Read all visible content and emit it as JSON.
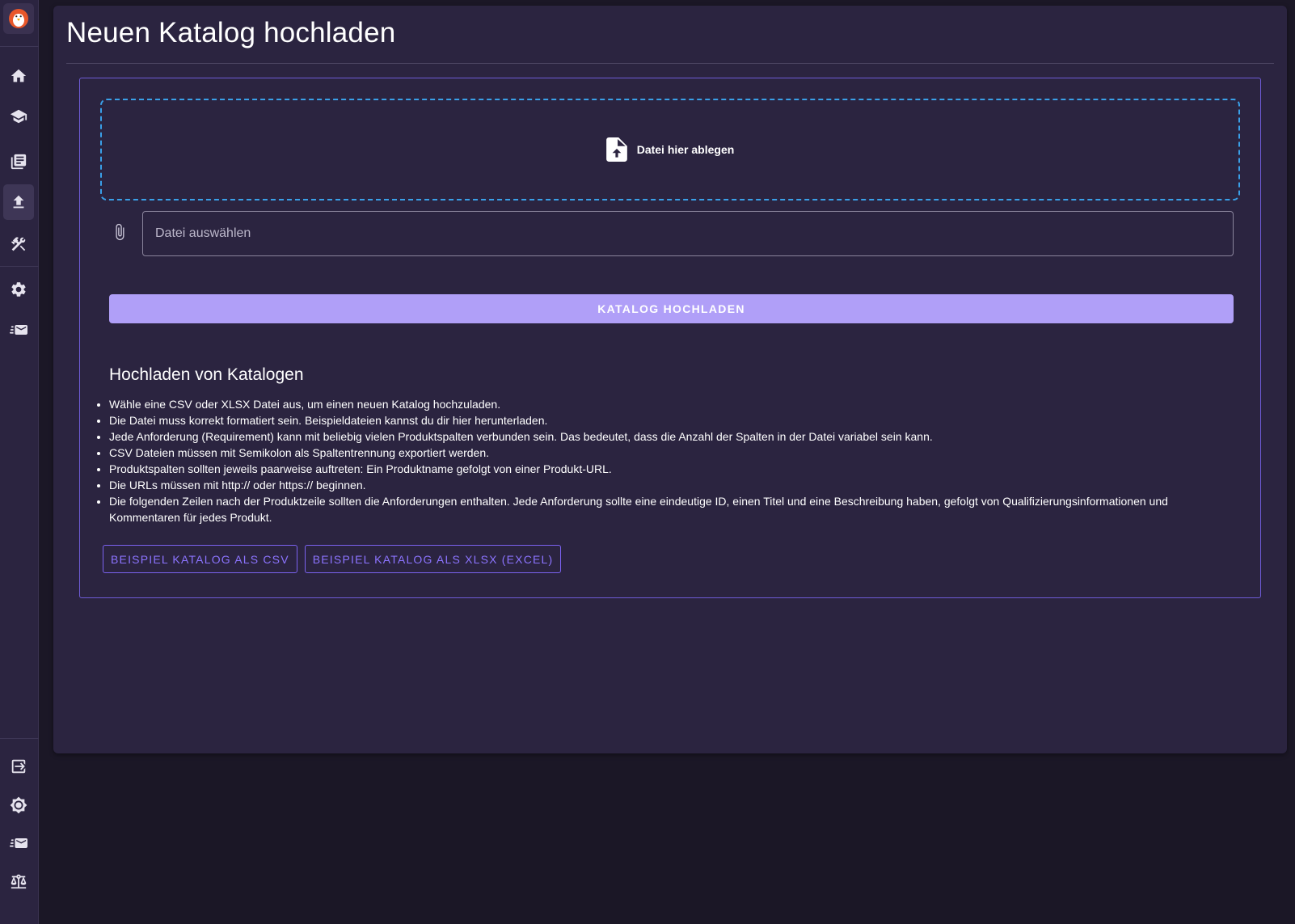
{
  "sidebar": {
    "logo": "penguin-logo",
    "items": [
      {
        "name": "home",
        "icon": "home-icon"
      },
      {
        "name": "courses",
        "icon": "graduation-cap-icon"
      },
      {
        "name": "catalogs",
        "icon": "library-books-icon"
      },
      {
        "name": "upload",
        "icon": "upload-icon",
        "active": true
      },
      {
        "name": "tools",
        "icon": "tools-icon"
      },
      {
        "name": "settings",
        "icon": "gear-icon"
      },
      {
        "name": "mail",
        "icon": "fast-mail-icon"
      }
    ],
    "bottom_items": [
      {
        "name": "logout",
        "icon": "logout-icon"
      },
      {
        "name": "theme",
        "icon": "brightness-icon"
      },
      {
        "name": "contact",
        "icon": "fast-mail-icon"
      },
      {
        "name": "legal",
        "icon": "scale-icon"
      }
    ]
  },
  "page": {
    "title": "Neuen Katalog hochladen"
  },
  "upload": {
    "dropzone_label": "Datei hier ablegen",
    "file_placeholder": "Datei auswählen",
    "file_value": "",
    "submit_label": "KATALOG HOCHLADEN"
  },
  "info": {
    "title": "Hochladen von Katalogen",
    "bullets": [
      "Wähle eine CSV oder XLSX Datei aus, um einen neuen Katalog hochzuladen.",
      "Die Datei muss korrekt formatiert sein. Beispieldateien kannst du dir hier herunterladen.",
      "Jede Anforderung (Requirement) kann mit beliebig vielen Produktspalten verbunden sein. Das bedeutet, dass die Anzahl der Spalten in der Datei variabel sein kann.",
      "CSV Dateien müssen mit Semikolon als Spaltentrennung exportiert werden.",
      "Produktspalten sollten jeweils paarweise auftreten: Ein Produktname gefolgt von einer Produkt-URL.",
      "Die URLs müssen mit http:// oder https:// beginnen.",
      "Die folgenden Zeilen nach der Produktzeile sollten die Anforderungen enthalten. Jede Anforderung sollte eine eindeutige ID, einen Titel und eine Beschreibung haben, gefolgt von Qualifizierungsinformationen und Kommentaren für jedes Produkt."
    ]
  },
  "examples": {
    "csv_label": "BEISPIEL KATALOG ALS CSV",
    "xlsx_label": "BEISPIEL KATALOG ALS XLSX (EXCEL)"
  },
  "colors": {
    "background": "#1b1726",
    "panel": "#2b2440",
    "accent": "#b09ff8",
    "outline": "#7b62f0",
    "dropzone_border": "#3aa0e8"
  }
}
